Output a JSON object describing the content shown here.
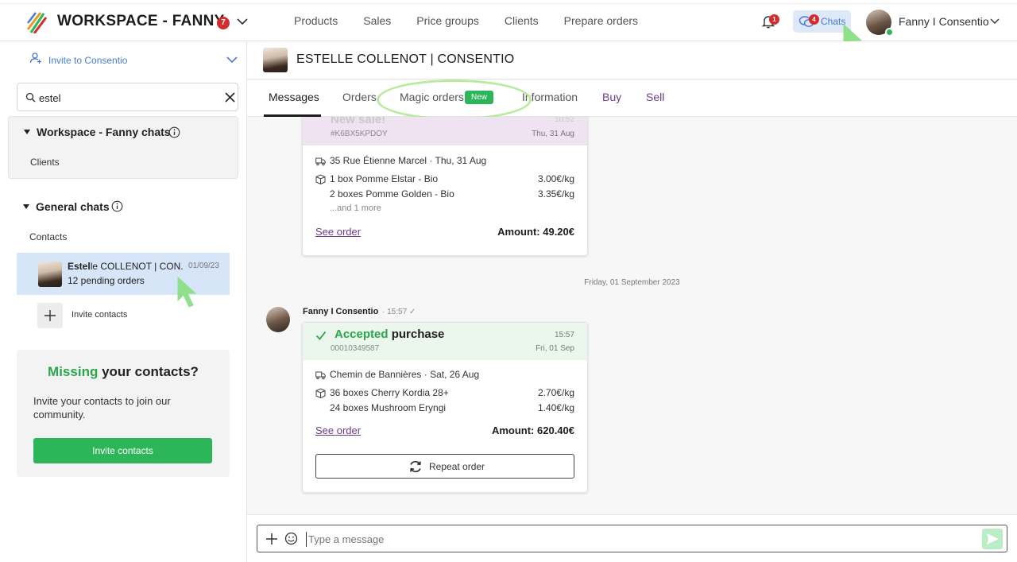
{
  "header": {
    "workspace_title": "WORKSPACE - FANNY",
    "workspace_badge": "7",
    "nav": [
      "Products",
      "Sales",
      "Price groups",
      "Clients",
      "Prepare orders"
    ],
    "notifications_badge": "1",
    "chats_badge": "4",
    "chats_label": "Chats",
    "user_name": "Fanny I Consentio"
  },
  "sidebar": {
    "invite_label": "Invite to Consentio",
    "search_value": "estel",
    "workspace_group": {
      "title": "Workspace - Fanny chats",
      "sub": "Clients"
    },
    "general_group": {
      "title": "General chats",
      "sub": "Contacts"
    },
    "contact": {
      "name_bold": "Estel",
      "name_rest": "le COLLENOT | CON...",
      "date": "01/09/23",
      "sub": "12 pending orders"
    },
    "invite_contacts_label": "Invite contacts",
    "missing": {
      "title_highlight": "Missing",
      "title_rest": "your contacts?",
      "text": "Invite your contacts to join our community.",
      "button": "Invite contacts"
    }
  },
  "chat": {
    "title": "ESTELLE COLLENOT | CONSENTIO",
    "tabs": [
      "Messages",
      "Orders",
      "Magic orders",
      "Information",
      "Buy",
      "Sell"
    ],
    "new_badge": "New",
    "card1": {
      "title": "New sale!",
      "id": "#K6BX5KPDOY",
      "time": "10:52",
      "date": "Thu, 31 Aug",
      "address": "35 Rue Étienne Marcel · Thu, 31 Aug",
      "items": [
        {
          "name": "1 box Pomme Elstar - Bio",
          "price": "3.00€/kg"
        },
        {
          "name": "2 boxes Pomme Golden - Bio",
          "price": "3.35€/kg"
        }
      ],
      "more": "...and 1 more",
      "see_order": "See order",
      "amount_label": "Amount:",
      "amount_value": "49.20€"
    },
    "date_separator": "Friday, 01 September 2023",
    "sender": {
      "name": "Fanny I Consentio",
      "time": "· 15:57 ✓"
    },
    "card2": {
      "title_status": "Accepted",
      "title_rest": "purchase",
      "id": "00010349587",
      "time": "15:57",
      "date": "Fri, 01 Sep",
      "address": "Chemin de Bannières · Sat, 26 Aug",
      "items": [
        {
          "name": "36 boxes Cherry Kordia 28+",
          "price": "2.70€/kg"
        },
        {
          "name": "24 boxes Mushroom Eryngi",
          "price": "1.40€/kg"
        }
      ],
      "see_order": "See order",
      "amount_label": "Amount:",
      "amount_value": "620.40€",
      "repeat_label": "Repeat order"
    },
    "composer_placeholder": "Type a message"
  },
  "colors": {
    "accent_green": "#2db55a",
    "link_purple": "#6e3b8f",
    "badge_red": "#d42c2c",
    "link_blue": "#4a7bd0"
  },
  "icons": [
    "logo-icon",
    "chevron-down-icon",
    "bell-icon",
    "chats-icon",
    "invite-user-icon",
    "search-icon",
    "close-icon",
    "info-icon",
    "plus-icon",
    "truck-icon",
    "box-icon",
    "check-icon",
    "repeat-icon",
    "emoji-icon",
    "send-icon",
    "cursor-arrow-icon"
  ]
}
